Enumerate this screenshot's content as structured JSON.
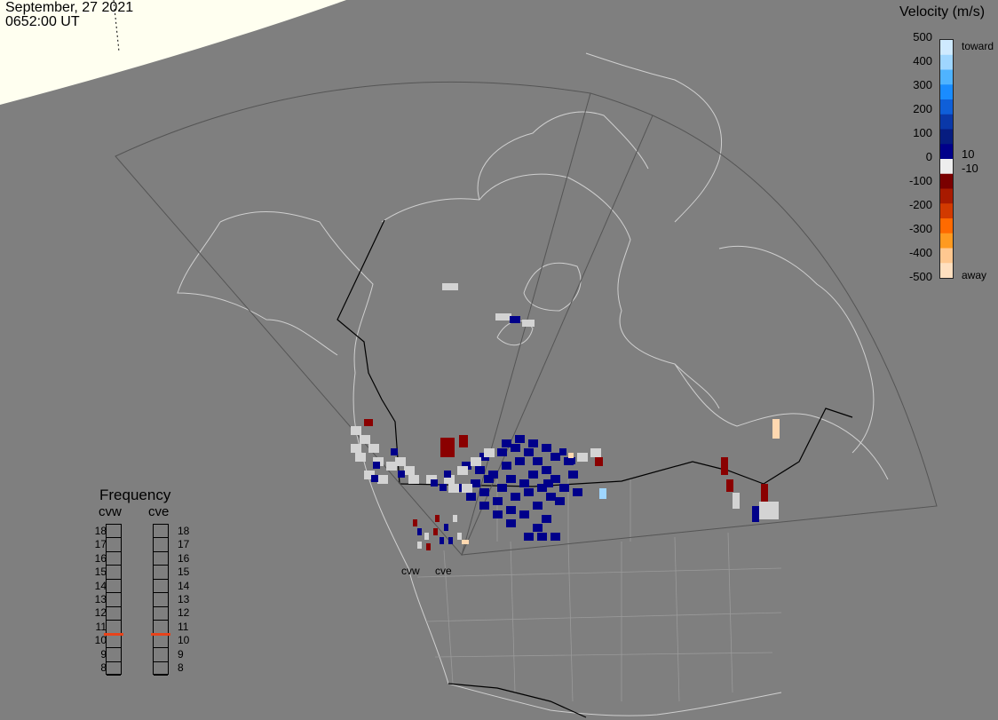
{
  "header": {
    "date": "September, 27 2021",
    "time": "0652:00 UT"
  },
  "legend": {
    "title": "Velocity (m/s)",
    "ticks": [
      "500",
      "400",
      "300",
      "200",
      "100",
      "10",
      "0",
      "-10",
      "-100",
      "-200",
      "-300",
      "-400",
      "-500"
    ],
    "toward_label": "toward",
    "away_label": "away",
    "colors": [
      "#cfeaff",
      "#9fd6ff",
      "#4fb3ff",
      "#1a8cff",
      "#0f5fd8",
      "#0a38a8",
      "#061c80",
      "#00008a",
      "#eeeeee",
      "#7a0000",
      "#a81a00",
      "#d23a00",
      "#ff6a00",
      "#ff9a20",
      "#ffc890",
      "#ffe0c0"
    ]
  },
  "frequency": {
    "title": "Frequency",
    "radars": [
      {
        "name": "cvw",
        "selected": 10.5
      },
      {
        "name": "cve",
        "selected": 10.5
      }
    ],
    "levels": [
      "18",
      "17",
      "16",
      "15",
      "14",
      "13",
      "12",
      "11",
      "10",
      "9",
      "8"
    ]
  },
  "sites": [
    {
      "name": "cvw"
    },
    {
      "name": "cve"
    }
  ],
  "map": {
    "background": "#7f7f7f",
    "daylight": "#fffff0",
    "coast_color": "#cfcfcf",
    "border_color": "#000000",
    "fov_color": "#555555",
    "scatter_colors": {
      "toward_strong": "#00008a",
      "toward_light": "#9fd6ff",
      "gray": "#d3d3d3",
      "away_strong": "#8a0000",
      "away_light": "#ffd8b0"
    }
  }
}
